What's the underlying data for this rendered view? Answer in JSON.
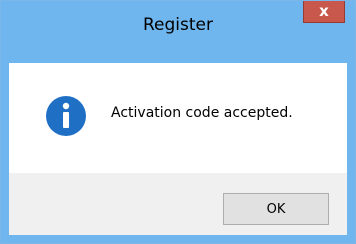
{
  "window": {
    "title": "Register",
    "close_glyph": "x",
    "frame_color": "#6fb5ee",
    "close_color": "#c8584c"
  },
  "message": {
    "icon": "info-icon",
    "icon_color": "#1f6fc5",
    "text": "Activation code accepted."
  },
  "buttons": {
    "ok_label": "OK"
  }
}
